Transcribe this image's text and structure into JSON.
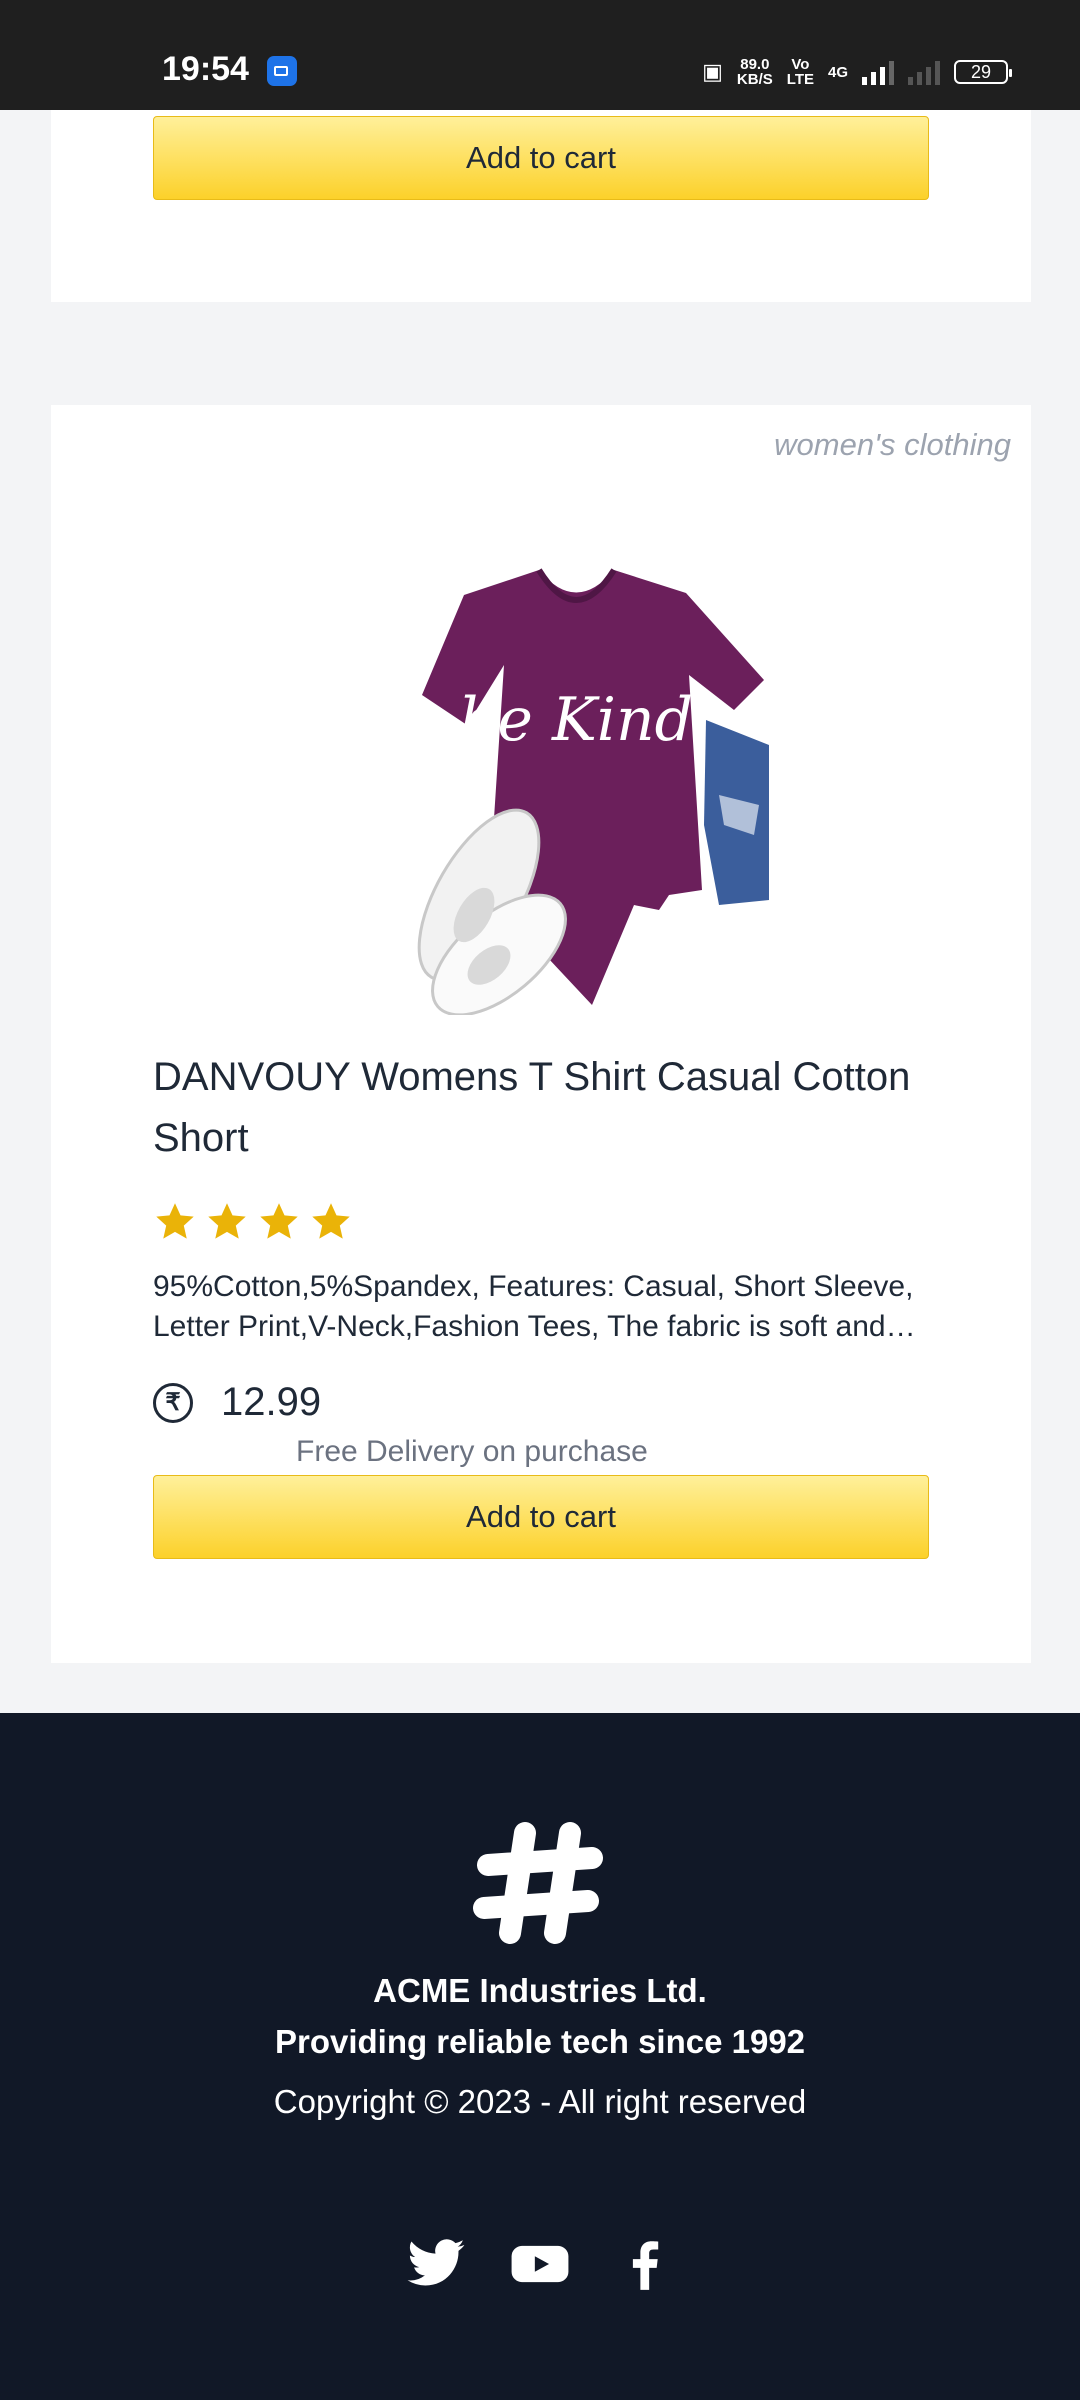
{
  "status_bar": {
    "time": "19:54",
    "speed_value": "89.0",
    "speed_unit": "KB/S",
    "volte": "Vo",
    "lte": "LTE",
    "network": "4G",
    "battery": "29"
  },
  "top_card": {
    "cart_label": "Add to cart"
  },
  "product": {
    "category": "women's clothing",
    "title": "DANVOUY Womens T Shirt Casual Cotton Short",
    "rating_stars": 4,
    "description": "95%Cotton,5%Spandex, Features: Casual, Short Sleeve, Letter Print,V-Neck,Fashion Tees, The fabric is soft and…",
    "currency_symbol": "₹",
    "price": "12.99",
    "delivery_note": "Free Delivery on purchase",
    "cart_label": "Add to cart",
    "image_print_text": "be Kind"
  },
  "footer": {
    "company": "ACME Industries Ltd.",
    "tagline": "Providing reliable tech since 1992",
    "copyright": "Copyright © 2023 - All right reserved",
    "social": [
      "twitter-icon",
      "youtube-icon",
      "facebook-icon"
    ]
  },
  "colors": {
    "button_top": "#fff09a",
    "button_bottom": "#fcd12a",
    "star": "#eab308",
    "footer_bg": "#111827",
    "shirt": "#6b1f5b"
  }
}
